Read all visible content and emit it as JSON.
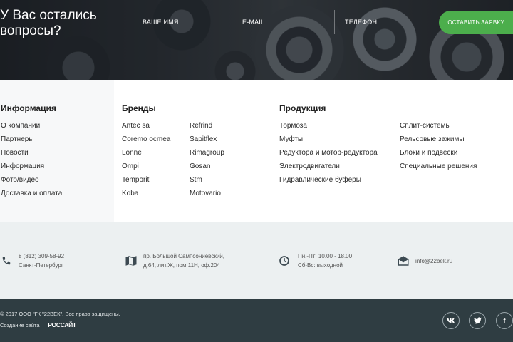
{
  "hero": {
    "title": "У Вас остались вопросы?",
    "name_placeholder": "ВАШЕ ИМЯ",
    "email_placeholder": "E-MAIL",
    "phone_placeholder": "ТЕЛЕФОН",
    "submit_label": "ОСТАВИТЬ ЗАЯВКУ"
  },
  "columns": {
    "info": {
      "title": "Информация",
      "items": [
        "О компании",
        "Партнеры",
        "Новости",
        "Информация",
        "Фото/видео",
        "Доставка и оплата"
      ]
    },
    "brands": {
      "title": "Бренды",
      "items_a": [
        "Antec sa",
        "Coremo ocmea",
        "Lonne",
        "Ompi",
        "Temporiti",
        "Koba"
      ],
      "items_b": [
        "Refrind",
        "Sapitflex",
        "Rimagroup",
        "Gosan",
        "Stm",
        "Motovario"
      ]
    },
    "products": {
      "title": "Продукция",
      "items_a": [
        "Тормоза",
        "Муфты",
        "Редуктора и мотор-редуктора",
        "Электродвигатели",
        "Гидравлические буферы"
      ],
      "items_b": [
        "Сплит-системы",
        "Рельсовые зажимы",
        "Блоки и подвески",
        "Специальные решения"
      ]
    }
  },
  "contacts": {
    "phone": "8 (812) 309-58-92",
    "city": "Санкт-Петербург",
    "address_line1": "пр. Большой Сампсониевский,",
    "address_line2": "д.64, лит.Ж, пом.11Н, оф.204",
    "hours_line1": "Пн.-Пт: 10.00 - 18.00",
    "hours_line2": "Сб-Вс: выходной",
    "email": "info@22bek.ru"
  },
  "footer": {
    "copyright": "© 2017 ООО \"ГК \"22ВЕК\". Все права защищены.",
    "made_by_prefix": "Создание сайта —",
    "made_by_brand": "РОССАЙТ",
    "social": {
      "vk": "vk",
      "twitter": "twitter",
      "facebook": "f"
    }
  },
  "colors": {
    "accent": "#4cae4c",
    "footer_bg": "#2f3d42",
    "contacts_bg": "#ecf0f1"
  }
}
